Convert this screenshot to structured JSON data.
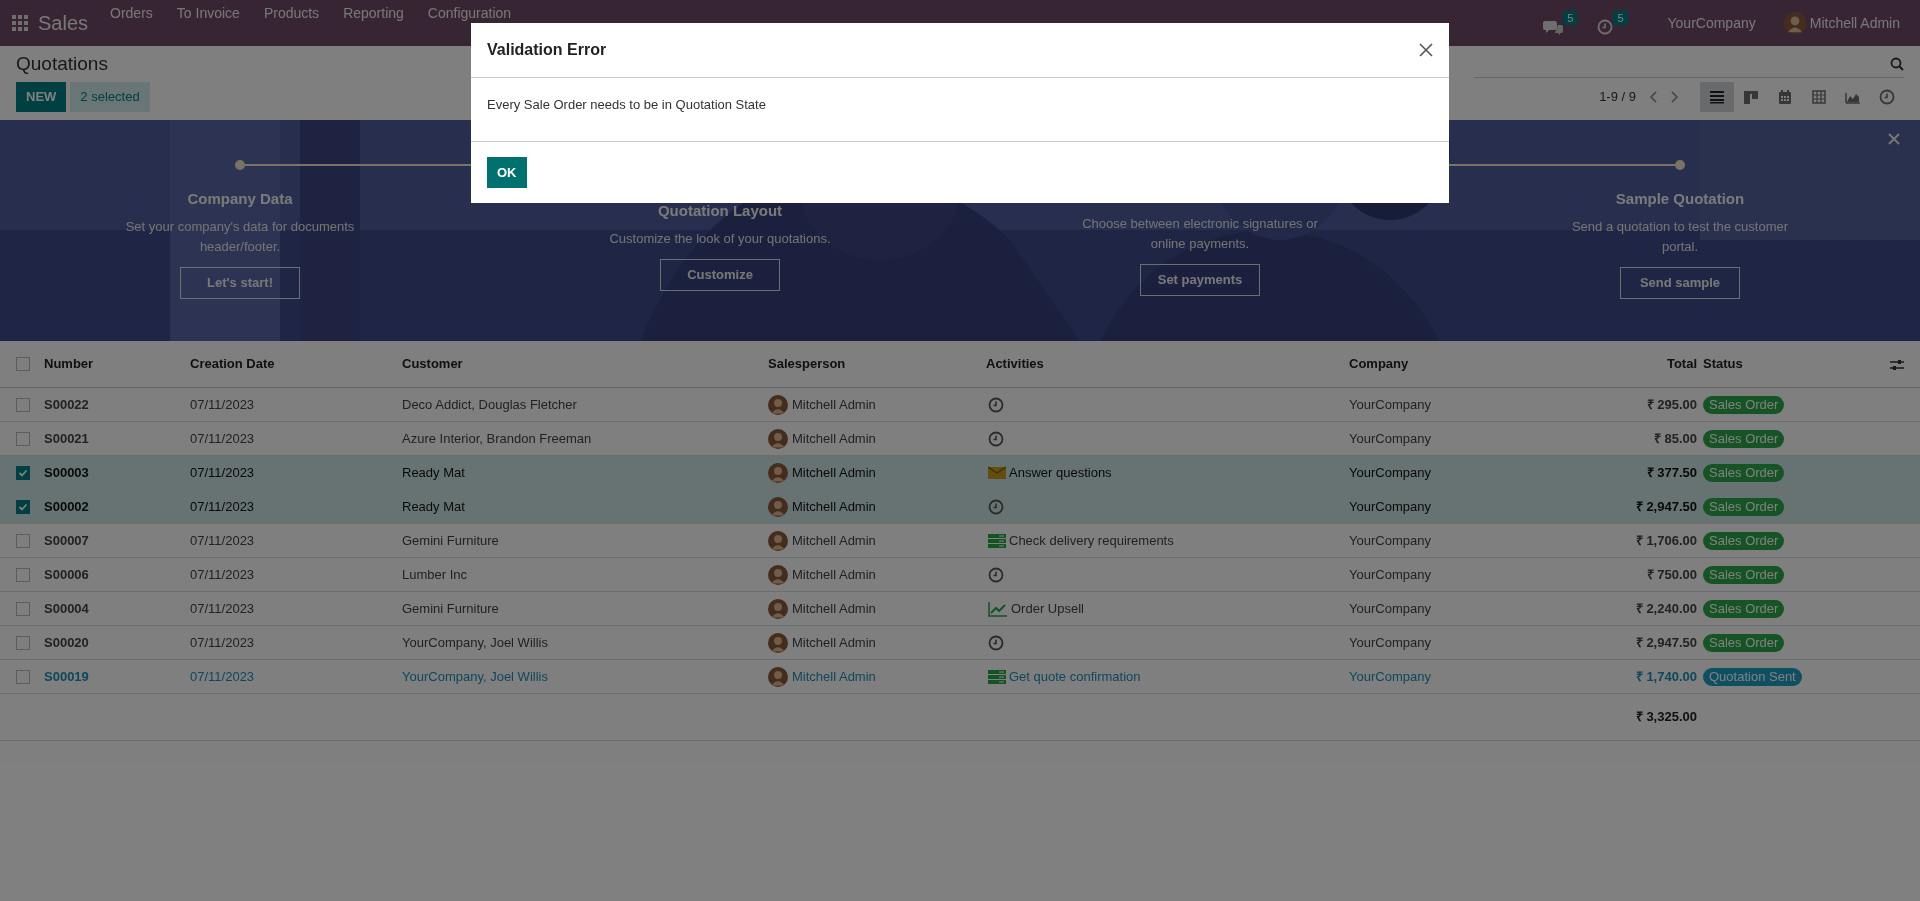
{
  "navbar": {
    "app": "Sales",
    "menu": [
      "Orders",
      "To Invoice",
      "Products",
      "Reporting",
      "Configuration"
    ],
    "messages_count": "5",
    "activities_count": "5",
    "company": "YourCompany",
    "user": "Mitchell Admin"
  },
  "control_panel": {
    "title": "Quotations",
    "new_button": "NEW",
    "selection": "2 selected",
    "pager": "1-9 / 9",
    "views": [
      {
        "kind": "list",
        "selected": true
      },
      {
        "kind": "kanban",
        "selected": false
      },
      {
        "kind": "calendar",
        "selected": false
      },
      {
        "kind": "pivot",
        "selected": false
      },
      {
        "kind": "graph",
        "selected": false
      },
      {
        "kind": "activity",
        "selected": false
      }
    ]
  },
  "banner": {
    "steps": [
      {
        "title": "Company Data",
        "description": "Set your company's data for documents header/footer.",
        "button": "Let's start!"
      },
      {
        "title": "Quotation Layout",
        "description": "Customize the look of your quotations.",
        "button": "Customize"
      },
      {
        "description": "Choose between electronic signatures or online payments.",
        "button": "Set payments"
      },
      {
        "title": "Sample Quotation",
        "description": "Send a quotation to test the customer portal.",
        "button": "Send sample"
      }
    ]
  },
  "table": {
    "select_all": {
      "checked": false
    },
    "columns": [
      "Number",
      "Creation Date",
      "Customer",
      "Salesperson",
      "Activities",
      "Company",
      "Total",
      "Status"
    ],
    "rows": [
      {
        "selected": false,
        "number": "S00022",
        "date": "07/11/2023",
        "customer": "Deco Addict, Douglas Fletcher",
        "salesperson": "Mitchell Admin",
        "activity": {
          "kind": "none"
        },
        "company": "YourCompany",
        "total": "₹ 295.00",
        "status": {
          "kind": "sale",
          "label": "Sales Order"
        }
      },
      {
        "selected": false,
        "number": "S00021",
        "date": "07/11/2023",
        "customer": "Azure Interior, Brandon Freeman",
        "salesperson": "Mitchell Admin",
        "activity": {
          "kind": "none"
        },
        "company": "YourCompany",
        "total": "₹ 85.00",
        "status": {
          "kind": "sale",
          "label": "Sales Order"
        }
      },
      {
        "selected": true,
        "number": "S00003",
        "date": "07/11/2023",
        "customer": "Ready Mat",
        "salesperson": "Mitchell Admin",
        "activity": {
          "kind": "email",
          "label": "Answer questions"
        },
        "company": "YourCompany",
        "total": "₹ 377.50",
        "status": {
          "kind": "sale",
          "label": "Sales Order"
        }
      },
      {
        "selected": true,
        "number": "S00002",
        "date": "07/11/2023",
        "customer": "Ready Mat",
        "salesperson": "Mitchell Admin",
        "activity": {
          "kind": "none"
        },
        "company": "YourCompany",
        "total": "₹ 2,947.50",
        "status": {
          "kind": "sale",
          "label": "Sales Order"
        }
      },
      {
        "selected": false,
        "number": "S00007",
        "date": "07/11/2023",
        "customer": "Gemini Furniture",
        "salesperson": "Mitchell Admin",
        "activity": {
          "kind": "todo",
          "label": "Check delivery requirements"
        },
        "company": "YourCompany",
        "total": "₹ 1,706.00",
        "status": {
          "kind": "sale",
          "label": "Sales Order"
        }
      },
      {
        "selected": false,
        "number": "S00006",
        "date": "07/11/2023",
        "customer": "Lumber Inc",
        "salesperson": "Mitchell Admin",
        "activity": {
          "kind": "none"
        },
        "company": "YourCompany",
        "total": "₹ 750.00",
        "status": {
          "kind": "sale",
          "label": "Sales Order"
        }
      },
      {
        "selected": false,
        "number": "S00004",
        "date": "07/11/2023",
        "customer": "Gemini Furniture",
        "salesperson": "Mitchell Admin",
        "activity": {
          "kind": "upsell",
          "label": "Order Upsell"
        },
        "company": "YourCompany",
        "total": "₹ 2,240.00",
        "status": {
          "kind": "sale",
          "label": "Sales Order"
        }
      },
      {
        "selected": false,
        "number": "S00020",
        "date": "07/11/2023",
        "customer": "YourCompany, Joel Willis",
        "salesperson": "Mitchell Admin",
        "activity": {
          "kind": "none"
        },
        "company": "YourCompany",
        "total": "₹ 2,947.50",
        "status": {
          "kind": "sale",
          "label": "Sales Order"
        }
      },
      {
        "selected": false,
        "number": "S00019",
        "date": "07/11/2023",
        "customer": "YourCompany, Joel Willis",
        "salesperson": "Mitchell Admin",
        "activity": {
          "kind": "todo",
          "label": "Get quote confirmation"
        },
        "company": "YourCompany",
        "total": "₹ 1,740.00",
        "status": {
          "kind": "sent",
          "label": "Quotation Sent"
        }
      }
    ],
    "footer_total": "₹ 3,325.00"
  },
  "dialog": {
    "title": "Validation Error",
    "message": "Every Sale Order needs to be in Quotation State",
    "button": "OK"
  }
}
